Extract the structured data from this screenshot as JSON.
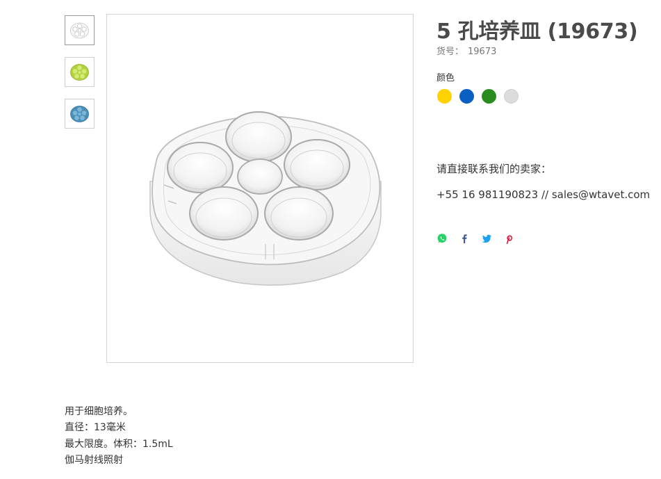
{
  "product": {
    "title": "5 孔培养皿 (19673)",
    "sku_label": "货号：",
    "sku_value": "19673"
  },
  "thumbnails": [
    {
      "name": "clear",
      "color": "#e8e8e8"
    },
    {
      "name": "lime",
      "color": "#a6c93a"
    },
    {
      "name": "blue",
      "color": "#4a8fb8"
    }
  ],
  "colors": {
    "label": "颜色",
    "swatches": [
      {
        "name": "yellow",
        "hex": "#ffd200"
      },
      {
        "name": "blue",
        "hex": "#0a5fc4"
      },
      {
        "name": "green",
        "hex": "#2a8c1e"
      },
      {
        "name": "gray",
        "hex": "#dcdcdc"
      }
    ]
  },
  "contact": {
    "heading": "请直接联系我们的卖家：",
    "info": "+55 16 981190823 // sales@wtavet.com"
  },
  "share": [
    {
      "name": "whatsapp-icon",
      "color": "#25d366"
    },
    {
      "name": "facebook-icon",
      "color": "#3b5998"
    },
    {
      "name": "twitter-icon",
      "color": "#1da1f2"
    },
    {
      "name": "pinterest-icon",
      "color": "#e60023"
    }
  ],
  "description": [
    "用于细胞培养。",
    "直径：13毫米",
    "最大限度。体积：1.5mL",
    "伽马射线照射"
  ]
}
